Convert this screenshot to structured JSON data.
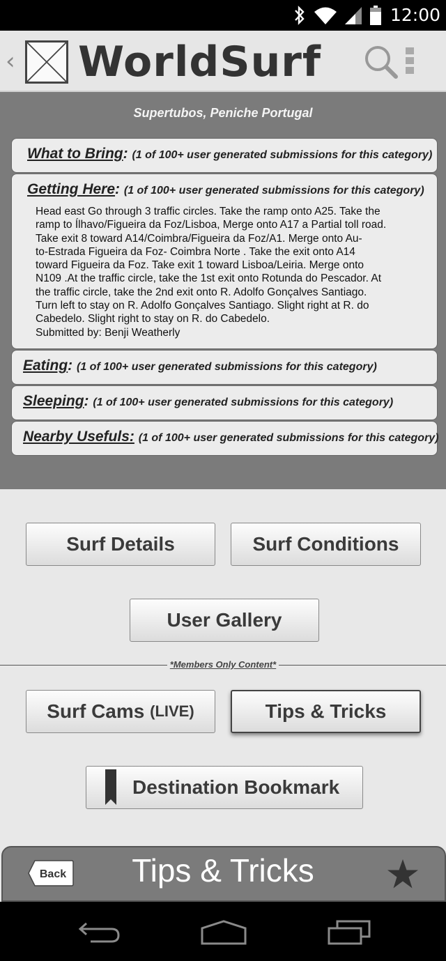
{
  "status_bar": {
    "time": "12:00"
  },
  "app_bar": {
    "title": "WorldSurf"
  },
  "location": "Supertubos, Peniche Portugal",
  "panels": [
    {
      "category": "What to Bring",
      "submissions": "(1 of 100+ user generated submissions for this category)"
    },
    {
      "category": "Getting Here",
      "submissions": "(1 of 100+ user generated submissions for this category)",
      "body_lines": [
        "Head east Go through 3 traffic circles. Take the ramp onto A25. Take the",
        "ramp to Ílhavo/Figueira da Foz/Lisboa, Merge onto A17 a Partial toll road.",
        "Take exit 8 toward A14/Coimbra/Figueira da Foz/A1. Merge onto Au-",
        "to-Estrada Figueira da Foz- Coimbra Norte . Take the exit onto A14",
        "toward Figueira da Foz. Take exit 1 toward Lisboa/Leiria. Merge onto",
        "N109 .At the traffic circle, take the 1st exit onto Rotunda do Pescador. At",
        "the traffic circle, take the 2nd exit onto R. Adolfo Gonçalves Santiago.",
        "Turn left to stay on R. Adolfo Gonçalves Santiago. Slight right at R. do",
        "Cabedelo. Slight right to stay on R. do Cabedelo.",
        "Submitted by: Benji Weatherly"
      ]
    },
    {
      "category": "Eating",
      "submissions": "(1 of 100+ user generated submissions for this category)"
    },
    {
      "category": "Sleeping",
      "submissions": "(1 of 100+ user generated submissions for this category)"
    },
    {
      "category": "Nearby Usefuls:",
      "submissions": "(1 of 100+ user generated submissions for this category)"
    }
  ],
  "buttons": {
    "surf_details": "Surf Details",
    "surf_conditions": "Surf Conditions",
    "user_gallery": "User Gallery",
    "members_only": "*Members Only Content*",
    "surf_cams": "Surf Cams",
    "surf_cams_live": "(LIVE)",
    "tips_tricks": "Tips & Tricks",
    "destination_bookmark": "Destination Bookmark"
  },
  "bottom_bar": {
    "back_label": "Back",
    "title": "Tips & Tricks"
  },
  "colors": {
    "content_gray": "#7b7b7b",
    "panel_bg": "#ececec",
    "button_area": "#e8e8e8"
  }
}
